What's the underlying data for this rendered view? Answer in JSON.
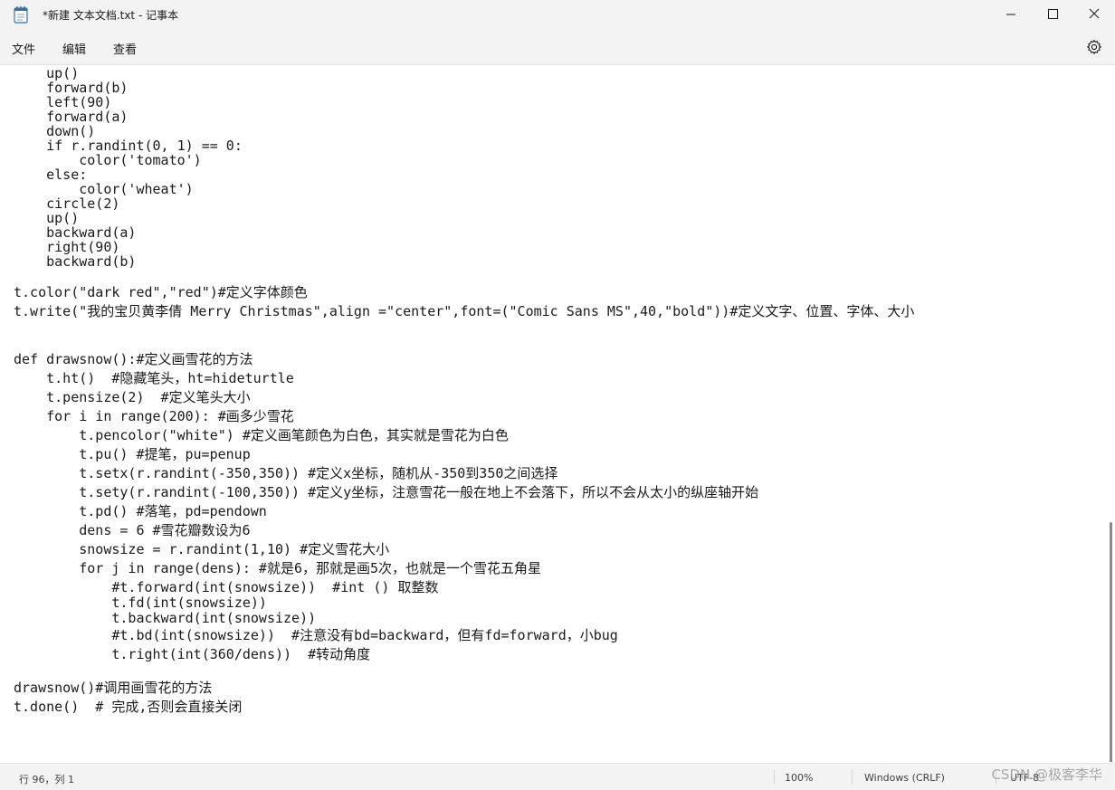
{
  "window": {
    "title": "*新建 文本文档.txt - 记事本"
  },
  "menu": {
    "file": "文件",
    "edit": "编辑",
    "view": "查看"
  },
  "editor": {
    "lines": [
      "    up()",
      "    forward(b)",
      "    left(90)",
      "    forward(a)",
      "    down()",
      "    if r.randint(0, 1) == 0:",
      "        color('tomato')",
      "    else:",
      "        color('wheat')",
      "    circle(2)",
      "    up()",
      "    backward(a)",
      "    right(90)",
      "    backward(b)",
      "t.color(\"dark red\",\"red\")#定义字体颜色",
      "t.write(\"我的宝贝黄李倩 Merry Christmas\",align =\"center\",font=(\"Comic Sans MS\",40,\"bold\"))#定义文字、位置、字体、大小",
      "def drawsnow():#定义画雪花的方法",
      "    t.ht()  #隐藏笔头，ht=hideturtle",
      "    t.pensize(2)  #定义笔头大小",
      "    for i in range(200): #画多少雪花",
      "        t.pencolor(\"white\") #定义画笔颜色为白色，其实就是雪花为白色",
      "        t.pu() #提笔，pu=penup",
      "        t.setx(r.randint(-350,350)) #定义x坐标，随机从-350到350之间选择",
      "        t.sety(r.randint(-100,350)) #定义y坐标，注意雪花一般在地上不会落下，所以不会从太小的纵座轴开始",
      "        t.pd() #落笔，pd=pendown",
      "        dens = 6 #雪花瓣数设为6",
      "        snowsize = r.randint(1,10) #定义雪花大小",
      "        for j in range(dens): #就是6，那就是画5次，也就是一个雪花五角星",
      "            #t.forward(int(snowsize))  #int () 取整数",
      "            t.fd(int(snowsize))",
      "            t.backward(int(snowsize))",
      "            #t.bd(int(snowsize))  #注意没有bd=backward，但有fd=forward，小bug",
      "            t.right(int(360/dens))  #转动角度",
      "drawsnow()#调用画雪花的方法",
      "t.done()  # 完成,否则会直接关闭"
    ]
  },
  "status": {
    "position": "行 96，列 1",
    "zoom": "100%",
    "line_ending": "Windows (CRLF)",
    "encoding": "UTF-8"
  },
  "watermark": "CSDN @极客李华",
  "icons": {
    "app": "notepad-icon",
    "settings": "gear-icon",
    "minimize": "minimize-icon",
    "maximize": "maximize-icon",
    "close": "close-icon"
  },
  "colors": {
    "chrome": "#f3f3f3",
    "editor_bg": "#ffffff",
    "text": "#1a1a1a"
  }
}
